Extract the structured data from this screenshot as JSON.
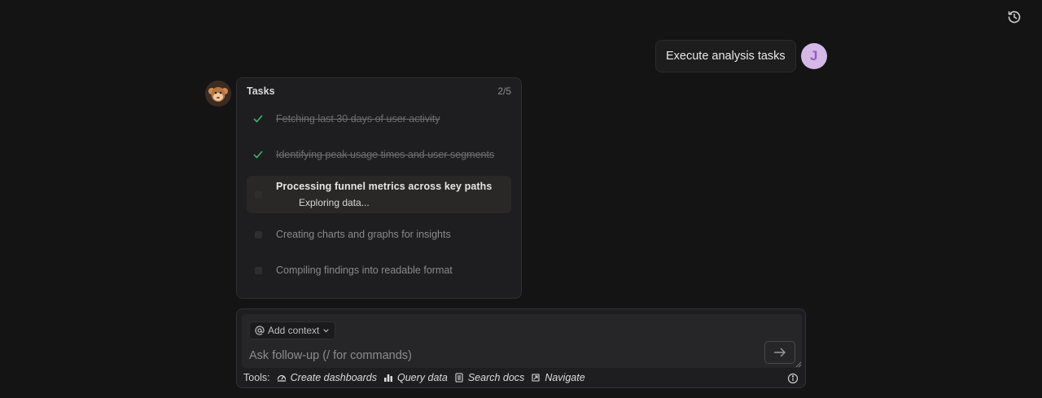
{
  "header": {
    "history_icon": "history-icon"
  },
  "user_message": {
    "text": "Execute analysis tasks",
    "avatar_initial": "J",
    "avatar_color": "#d4b8e8"
  },
  "assistant": {
    "avatar_icon": "monkey-avatar",
    "tasks": {
      "title": "Tasks",
      "count": "2/5",
      "items": [
        {
          "label": "Fetching last 30 days of user activity",
          "status": "done"
        },
        {
          "label": "Identifying peak usage times and user segments",
          "status": "done"
        },
        {
          "label": "Processing funnel metrics across key paths",
          "status": "active",
          "sublabel": "Exploring data..."
        },
        {
          "label": "Creating charts and graphs for insights",
          "status": "pending"
        },
        {
          "label": "Compiling findings into readable format",
          "status": "pending"
        }
      ]
    }
  },
  "composer": {
    "add_context_label": "Add context",
    "placeholder": "Ask follow-up (/ for commands)",
    "tools_label": "Tools:",
    "tools": [
      {
        "label": "Create dashboards",
        "icon": "dashboard-icon"
      },
      {
        "label": "Query data",
        "icon": "bar-chart-icon"
      },
      {
        "label": "Search docs",
        "icon": "document-icon"
      },
      {
        "label": "Navigate",
        "icon": "navigate-icon"
      }
    ]
  },
  "colors": {
    "background": "#141414",
    "check_green": "#3fae6a",
    "card": "#1e1e20"
  }
}
